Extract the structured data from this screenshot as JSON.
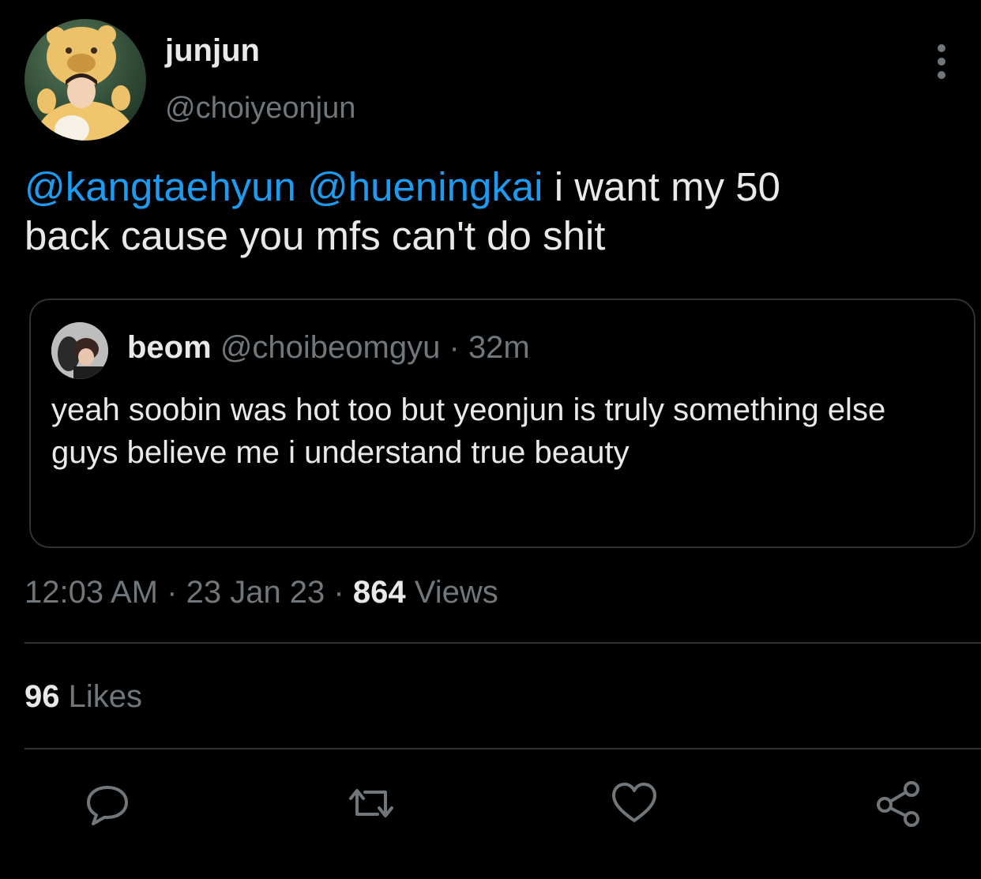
{
  "tweet": {
    "author": {
      "name": "junjun",
      "handle": "@choiyeonjun"
    },
    "text": {
      "mention1": "@kangtaehyun",
      "mention2": "@hueningkai",
      "body_line1": "i want my 50",
      "body_line2": "back cause you mfs can't do shit"
    },
    "quote": {
      "name": "beom",
      "handle": "@choibeomgyu",
      "separator": "·",
      "time": "32m",
      "text": "yeah soobin was hot too but yeonjun is truly something else guys believe me i understand true beauty"
    },
    "meta": {
      "time": "12:03 AM",
      "sep1": "·",
      "date": "23 Jan 23",
      "sep2": "·",
      "views_count": "864",
      "views_label": "Views"
    },
    "likes": {
      "count": "96",
      "label": "Likes"
    },
    "icons": {
      "more": "more-vertical-icon",
      "reply": "reply-icon",
      "retweet": "retweet-icon",
      "like": "heart-icon",
      "share": "share-icon"
    },
    "colors": {
      "background": "#000000",
      "text": "#e7e9ea",
      "secondary": "#71767b",
      "link": "#1d9bf0",
      "border": "#2f3336"
    }
  }
}
